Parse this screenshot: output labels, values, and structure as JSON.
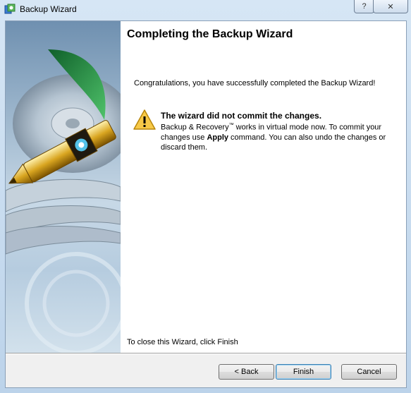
{
  "window": {
    "title": "Backup Wizard",
    "help_label": "?",
    "close_label": "✕"
  },
  "page": {
    "heading": "Completing the Backup Wizard",
    "congratulations": "Congratulations, you have successfully completed the Backup Wizard!",
    "warning_title": "The wizard did not commit the changes.",
    "warning_text_1": "Backup & Recovery",
    "warning_tm": "™",
    "warning_text_2": " works in virtual mode now. To commit your changes use ",
    "warning_apply": "Apply",
    "warning_text_3": " command. You can also undo the changes or discard them.",
    "close_hint": "To close this Wizard, click Finish"
  },
  "buttons": {
    "back": "< Back",
    "finish": "Finish",
    "cancel": "Cancel"
  },
  "colors": {
    "accent": "#3c7fb1",
    "warning": "#f5c518"
  }
}
